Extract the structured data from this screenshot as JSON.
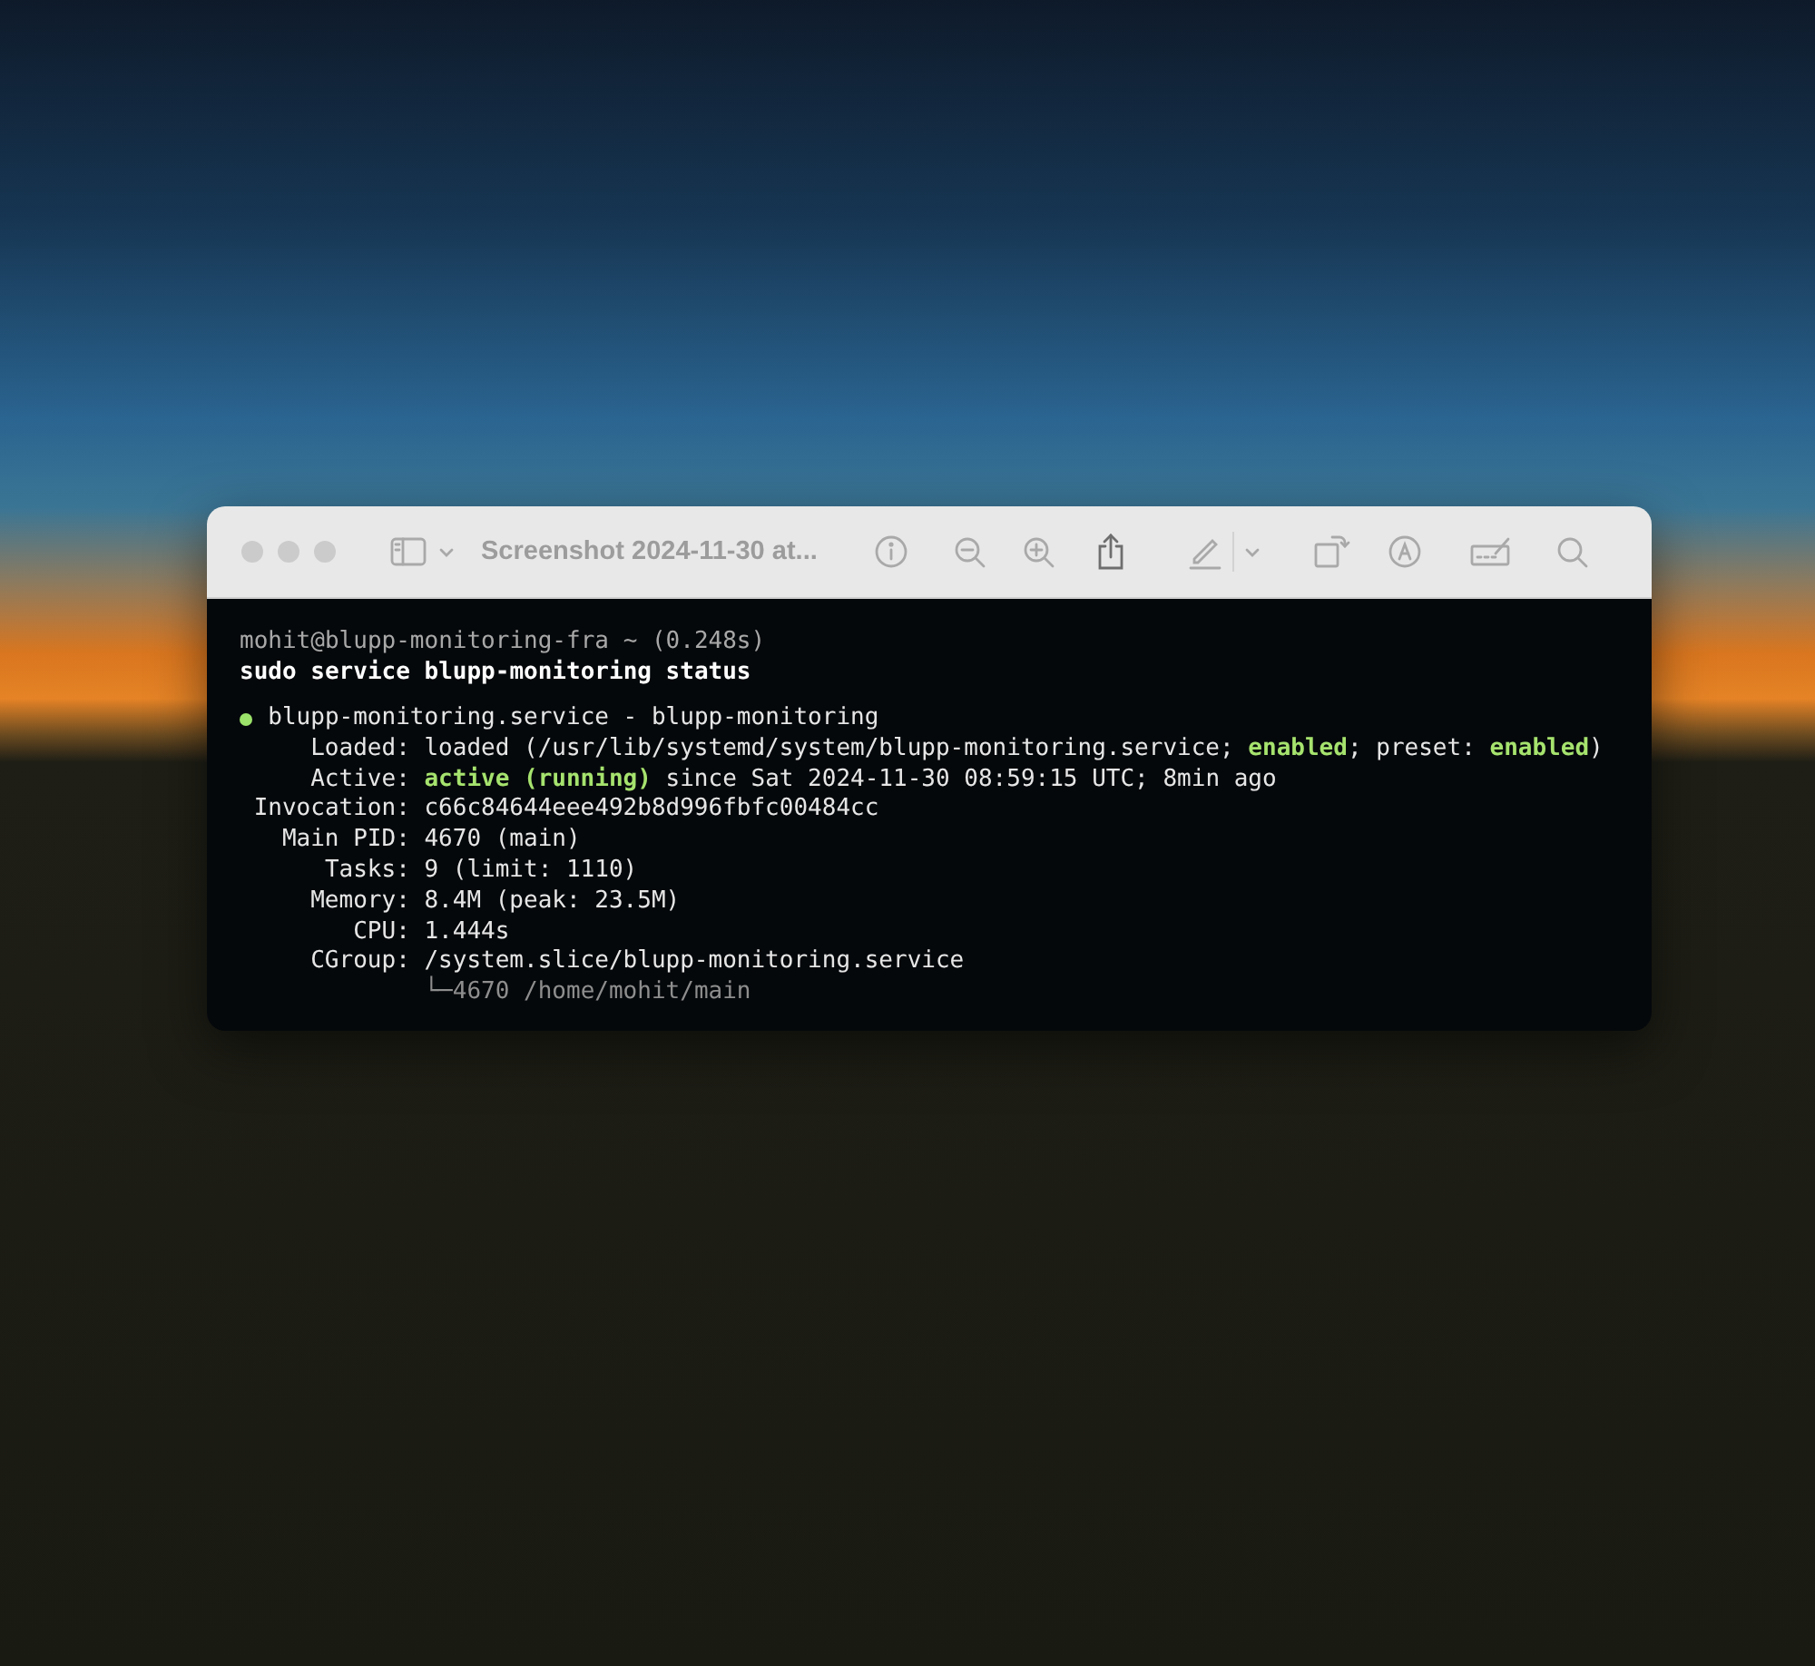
{
  "window": {
    "title": "Screenshot 2024-11-30 at..."
  },
  "terminal": {
    "prompt": "mohit@blupp-monitoring-fra ~ (0.248s)",
    "command": "sudo service blupp-monitoring status",
    "unit": {
      "color": "#9be36a",
      "title": "blupp-monitoring.service - blupp-monitoring"
    },
    "fields": [
      {
        "label": "Loaded:",
        "value": [
          {
            "text": "loaded (/usr/lib/systemd/system/blupp-monitoring.service; ",
            "kind": "plain"
          },
          {
            "text": "enabled",
            "kind": "highlight"
          },
          {
            "text": "; preset: ",
            "kind": "plain"
          },
          {
            "text": "enabled",
            "kind": "highlight"
          },
          {
            "text": ")",
            "kind": "plain"
          }
        ]
      },
      {
        "label": "Active:",
        "value": [
          {
            "text": "active (running)",
            "kind": "highlight"
          },
          {
            "text": " since Sat 2024-11-30 08:59:15 UTC; 8min ago",
            "kind": "plain"
          }
        ]
      },
      {
        "label": "Invocation:",
        "value": [
          {
            "text": "c66c84644eee492b8d996fbfc00484cc",
            "kind": "plain"
          }
        ]
      },
      {
        "label": "Main PID:",
        "value": [
          {
            "text": "4670 (main)",
            "kind": "plain"
          }
        ]
      },
      {
        "label": "Tasks:",
        "value": [
          {
            "text": "9 (limit: 1110)",
            "kind": "plain"
          }
        ]
      },
      {
        "label": "Memory:",
        "value": [
          {
            "text": "8.4M (peak: 23.5M)",
            "kind": "plain"
          }
        ]
      },
      {
        "label": "CPU:",
        "value": [
          {
            "text": "1.444s",
            "kind": "plain"
          }
        ]
      },
      {
        "label": "CGroup:",
        "value": [
          {
            "text": "/system.slice/blupp-monitoring.service",
            "kind": "plain"
          }
        ]
      }
    ],
    "tree": [
      "└─4670 /home/mohit/main"
    ]
  }
}
